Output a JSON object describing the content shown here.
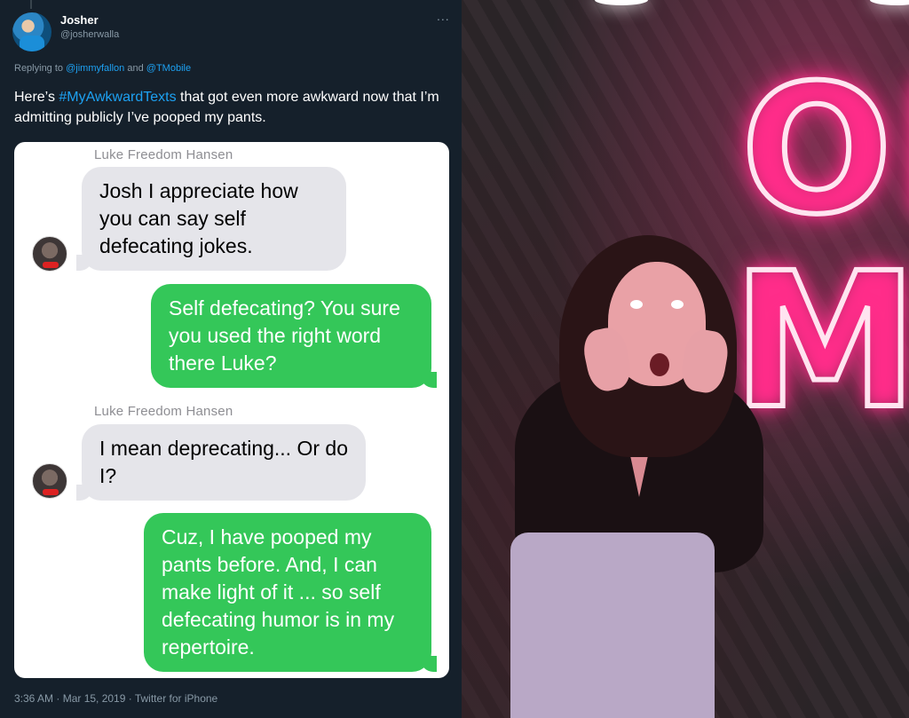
{
  "tweet": {
    "display_name": "Josher",
    "handle": "@josherwalla",
    "more_icon": "...",
    "replying_prefix": "Replying to",
    "replying_user1": "@jimmyfallon",
    "replying_and": "and",
    "replying_user2": "@TMobile",
    "text_before": "Here’s ",
    "hashtag": "#MyAwkwardTexts",
    "text_after": " that got even more awkward now that I’m admitting publicly I’ve pooped my pants.",
    "timestamp": "3:36 AM · Mar 15, 2019 · Twitter for iPhone"
  },
  "messages": {
    "sender1": "Luke Freedom Hansen",
    "msg1": "Josh I appreciate how you can say self defecating jokes.",
    "msg2": "Self defecating? You sure you used the right word there Luke?",
    "sender2": "Luke Freedom Hansen",
    "msg3": "I mean deprecating... Or do I?",
    "msg4": "Cuz, I have pooped my pants before. And, I can make light of it ... so self defecating humor is in my repertoire."
  },
  "colors": {
    "tweet_bg": "#15202b",
    "link": "#1da1f2",
    "incoming_bubble": "#e5e5ea",
    "outgoing_bubble": "#34c759",
    "neon": "#ff2d8a"
  },
  "photo": {
    "neon_line1": "OH",
    "neon_line2": "MY"
  }
}
